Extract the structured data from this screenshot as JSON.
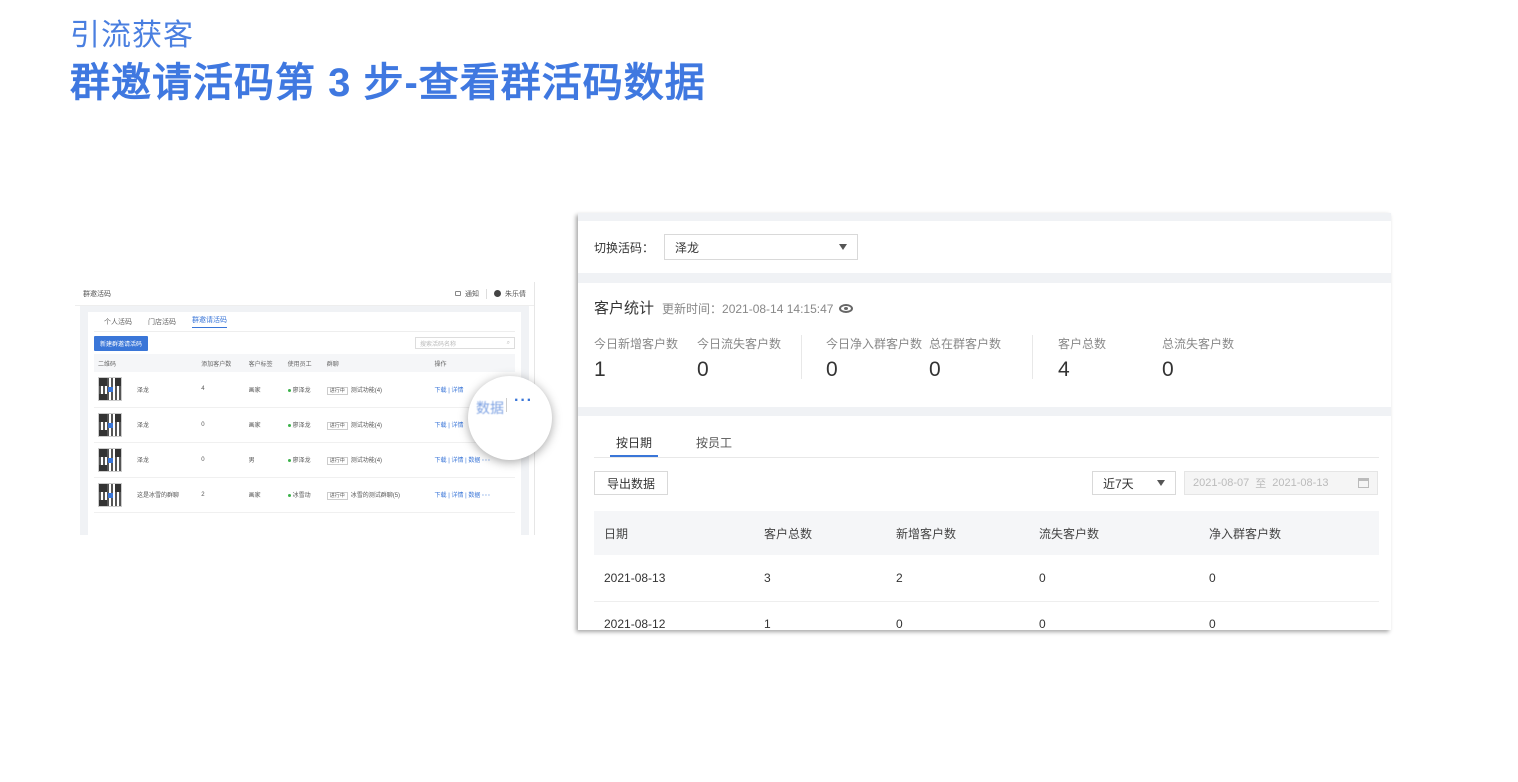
{
  "header": {
    "kicker": "引流获客",
    "title": "群邀请活码第 3 步-查看群活码数据"
  },
  "left_shot": {
    "page_title": "群邀活码",
    "notifications": "通知",
    "user_name": "朱乐倩",
    "tabs": [
      "个人活码",
      "门店活码",
      "群邀请活码"
    ],
    "create_button": "新建群邀请活码",
    "search_placeholder": "搜索活码名称",
    "columns": [
      "二维码",
      "添加客户数",
      "客户标签",
      "使用员工",
      "群聊",
      "操作"
    ],
    "rows": [
      {
        "name": "泽龙",
        "count": "4",
        "tag": "画家",
        "staff": "廖泽龙",
        "status": "进行中",
        "group": "测试功能(4)",
        "ops": [
          "下载",
          "详情",
          "数据"
        ]
      },
      {
        "name": "泽龙",
        "count": "0",
        "tag": "画家",
        "staff": "廖泽龙",
        "status": "进行中",
        "group": "测试功能(4)",
        "ops": [
          "下载",
          "详情",
          "数据"
        ]
      },
      {
        "name": "泽龙",
        "count": "0",
        "tag": "男",
        "staff": "廖泽龙",
        "status": "进行中",
        "group": "测试功能(4)",
        "ops": [
          "下载",
          "详情",
          "数据"
        ]
      },
      {
        "name": "这是冰雪的群聊",
        "count": "2",
        "tag": "画家",
        "staff": "冰雪动",
        "status": "进行中",
        "group": "冰雪的测试群聊(5)",
        "ops": [
          "下载",
          "详情",
          "数据"
        ]
      }
    ],
    "magnifier": {
      "data_label": "数据",
      "more_label": "···"
    }
  },
  "right_shot": {
    "switch_label": "切换活码：",
    "switch_value": "泽龙",
    "stats": {
      "title": "客户统计",
      "update_label": "更新时间：2021-08-14 14:15:47",
      "items": [
        {
          "label": "今日新增客户数",
          "value": "1"
        },
        {
          "label": "今日流失客户数",
          "value": "0"
        },
        {
          "label": "今日净入群客户数",
          "value": "0"
        },
        {
          "label": "总在群客户数",
          "value": "0"
        },
        {
          "label": "客户总数",
          "value": "4"
        },
        {
          "label": "总流失客户数",
          "value": "0"
        }
      ]
    },
    "tabs": [
      "按日期",
      "按员工"
    ],
    "export_button": "导出数据",
    "range_value": "近7天",
    "date_start": "2021-08-07",
    "date_to": "至",
    "date_end": "2021-08-13",
    "table": {
      "columns": [
        "日期",
        "客户总数",
        "新增客户数",
        "流失客户数",
        "净入群客户数"
      ],
      "rows": [
        [
          "2021-08-13",
          "3",
          "2",
          "0",
          "0"
        ],
        [
          "2021-08-12",
          "1",
          "0",
          "0",
          "0"
        ]
      ]
    }
  }
}
